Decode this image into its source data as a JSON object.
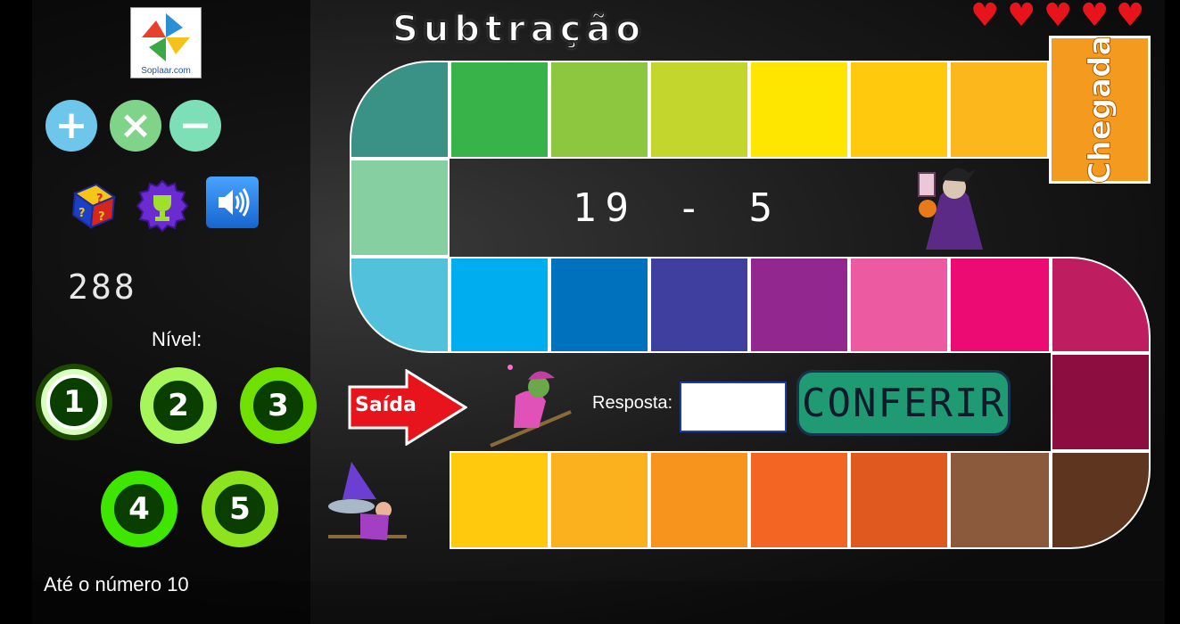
{
  "logo": {
    "text": "Soplaar.com"
  },
  "operations": [
    {
      "name": "plus",
      "symbol": "+",
      "color": "#6ec6ea"
    },
    {
      "name": "times",
      "symbol": "×",
      "color": "#7fd48a"
    },
    {
      "name": "minus",
      "symbol": "−",
      "color": "#7ddfb6"
    }
  ],
  "tools": {
    "help_icon": "question-box-icon",
    "trophy_icon": "trophy-icon",
    "sound_icon": "speaker-icon"
  },
  "score": "288",
  "level": {
    "label": "Nível:",
    "buttons": [
      "1",
      "2",
      "3",
      "4",
      "5"
    ],
    "selected": "1"
  },
  "range_text": "Até o número 10",
  "game": {
    "title": "Subtração",
    "lives": 5,
    "finish_label": "Chegada",
    "start_label": "Saída",
    "problem": {
      "a": "19",
      "op": "-",
      "b": "5"
    },
    "answer_label": "Resposta:",
    "answer_value": "",
    "check_label": "CONFERIR"
  },
  "colors": {
    "row1": [
      "#37b34a",
      "#8dc63f",
      "#c3d62e",
      "#ffe600",
      "#ffc90e",
      "#fbb71c"
    ],
    "row2": [
      "#00aeef",
      "#0071bc",
      "#3f3f9f",
      "#92278f",
      "#ec5ba2",
      "#ec0b73",
      "#be1e5f"
    ],
    "row3": [
      "#ffc90e",
      "#fbb11d",
      "#f7941d",
      "#f26522",
      "#e05a20",
      "#8b5a3c",
      "#5e3620"
    ],
    "left_top": "#3a9186",
    "left_mid": "#86cfa0",
    "left_low": "#52c2dc",
    "right_mid": "#8c0e40",
    "finish": "#f39a1f"
  }
}
